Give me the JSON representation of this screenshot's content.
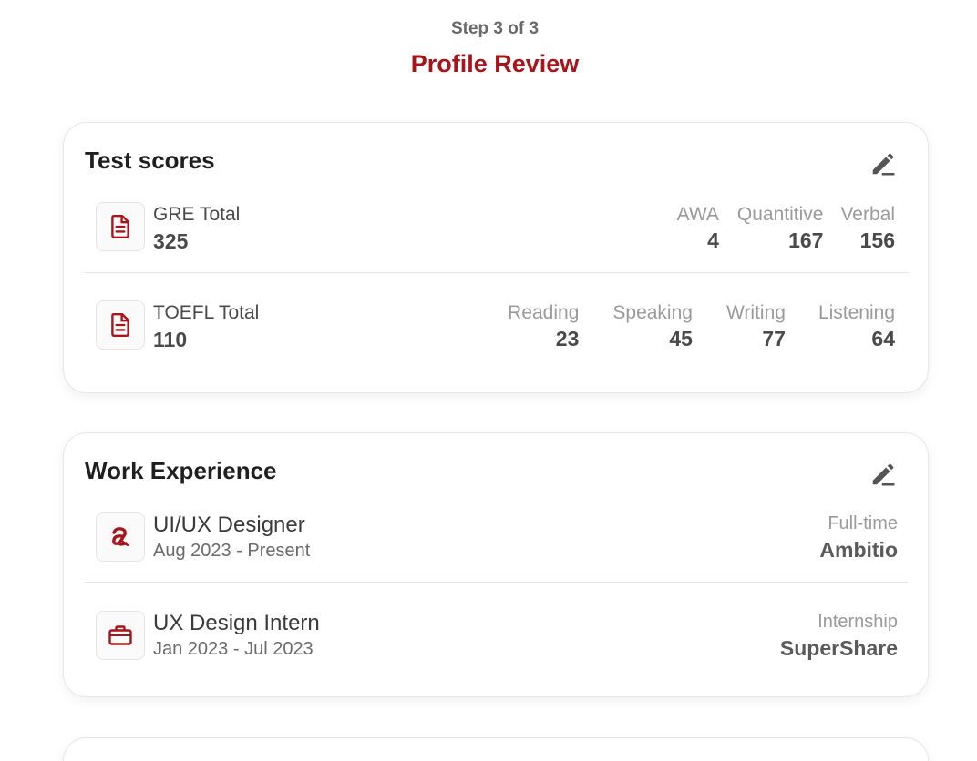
{
  "header": {
    "step": "Step 3 of 3",
    "title": "Profile Review"
  },
  "colors": {
    "accent": "#a8141a",
    "muted": "#9a9a9a",
    "text": "#4a4a4a"
  },
  "test_scores": {
    "title": "Test scores",
    "edit_icon": "pencil-icon",
    "gre": {
      "icon": "document-icon",
      "label": "GRE Total",
      "value": "325",
      "metrics": [
        {
          "label": "AWA",
          "value": "4"
        },
        {
          "label": "Quantitive",
          "value": "167"
        },
        {
          "label": "Verbal",
          "value": "156"
        }
      ]
    },
    "toefl": {
      "icon": "document-icon",
      "label": "TOEFL Total",
      "value": "110",
      "metrics": [
        {
          "label": "Reading",
          "value": "23"
        },
        {
          "label": "Speaking",
          "value": "45"
        },
        {
          "label": "Writing",
          "value": "77"
        },
        {
          "label": "Listening",
          "value": "64"
        }
      ]
    }
  },
  "work_experience": {
    "title": "Work Experience",
    "edit_icon": "pencil-icon",
    "jobs": [
      {
        "icon": "company-logo-icon",
        "title": "UI/UX Designer",
        "dates": "Aug 2023 - Present",
        "type": "Full-time",
        "company": "Ambitio"
      },
      {
        "icon": "briefcase-icon",
        "title": "UX Design Intern",
        "dates": "Jan 2023 - Jul 2023",
        "type": "Internship",
        "company": "SuperShare"
      }
    ]
  }
}
